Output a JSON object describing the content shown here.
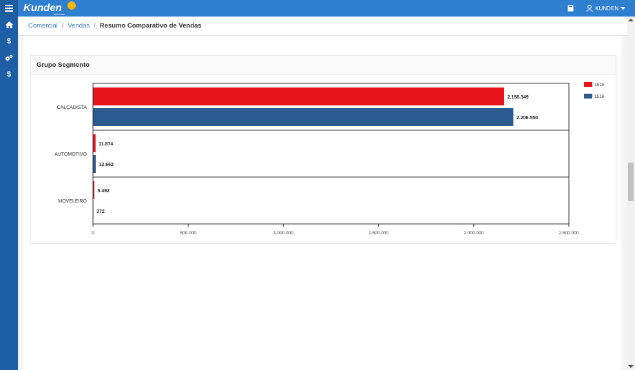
{
  "topbar": {
    "menu_icon": "hamburger-icon",
    "logo_text": "Kunden",
    "logo_sub": "sistemas",
    "user_label": "KUNDEN"
  },
  "sidebar": {
    "items": [
      {
        "icon": "home-icon"
      },
      {
        "icon": "dollar-icon",
        "glyph": "$"
      },
      {
        "icon": "gears-icon"
      },
      {
        "icon": "dollar-icon",
        "glyph": "$"
      }
    ]
  },
  "breadcrumb": {
    "items": [
      "Comercial",
      "Vendas"
    ],
    "current": "Resumo Comparativo de Vendas"
  },
  "panel": {
    "title": "Grupo Segmento"
  },
  "colors": {
    "series1": "#e8141c",
    "series2": "#2a5a8e",
    "accent": "#2f7fd1"
  },
  "chart_data": {
    "type": "bar",
    "orientation": "horizontal",
    "categories": [
      "CALÇADISTA",
      "AUTOMOTIVO",
      "MOVELEIRO"
    ],
    "series": [
      {
        "name": "1515",
        "values": [
          2158349,
          11874,
          5492
        ],
        "labels": [
          "2.158.349",
          "11.874",
          "5.492"
        ]
      },
      {
        "name": "1516",
        "values": [
          2206550,
          12662,
          372
        ],
        "labels": [
          "2.206.550",
          "12.662",
          "372"
        ]
      }
    ],
    "xlim": [
      0,
      2500000
    ],
    "xticks": [
      0,
      500000,
      1000000,
      1500000,
      2000000,
      2500000
    ],
    "xtick_labels": [
      "0",
      "500.000",
      "1.000.000",
      "1.500.000",
      "2.000.000",
      "2.500.000"
    ],
    "legend_position": "top-right",
    "grid": false
  }
}
